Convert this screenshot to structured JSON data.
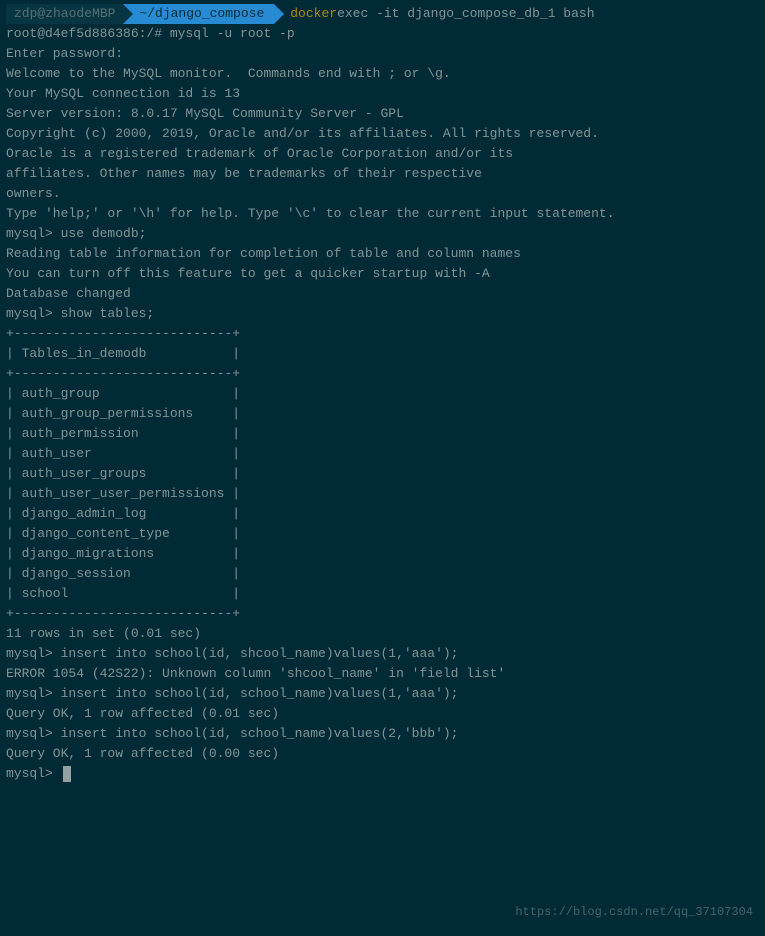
{
  "prompt": {
    "user_host": "zdp@zhaodeMBP",
    "path": "~/django_compose",
    "command_prefix": "docker",
    "command_args": " exec -it django_compose_db_1 bash"
  },
  "lines": {
    "l1": "root@d4ef5d886386:/# mysql -u root -p",
    "l2": "Enter password:",
    "l3": "Welcome to the MySQL monitor.  Commands end with ; or \\g.",
    "l4": "Your MySQL connection id is 13",
    "l5": "Server version: 8.0.17 MySQL Community Server - GPL",
    "l6": "",
    "l7": "Copyright (c) 2000, 2019, Oracle and/or its affiliates. All rights reserved.",
    "l8": "",
    "l9": "Oracle is a registered trademark of Oracle Corporation and/or its",
    "l10": "affiliates. Other names may be trademarks of their respective",
    "l11": "owners.",
    "l12": "",
    "l13": "Type 'help;' or '\\h' for help. Type '\\c' to clear the current input statement.",
    "l14": "",
    "l15": "mysql> use demodb;",
    "l16": "Reading table information for completion of table and column names",
    "l17": "You can turn off this feature to get a quicker startup with -A",
    "l18": "",
    "l19": "Database changed",
    "l20": "mysql> show tables;",
    "l21": "+----------------------------+",
    "l22": "| Tables_in_demodb           |",
    "l23": "+----------------------------+",
    "l24": "| auth_group                 |",
    "l25": "| auth_group_permissions     |",
    "l26": "| auth_permission            |",
    "l27": "| auth_user                  |",
    "l28": "| auth_user_groups           |",
    "l29": "| auth_user_user_permissions |",
    "l30": "| django_admin_log           |",
    "l31": "| django_content_type        |",
    "l32": "| django_migrations          |",
    "l33": "| django_session             |",
    "l34": "| school                     |",
    "l35": "+----------------------------+",
    "l36": "11 rows in set (0.01 sec)",
    "l37": "",
    "l38": "mysql> insert into school(id, shcool_name)values(1,'aaa');",
    "l39": "ERROR 1054 (42S22): Unknown column 'shcool_name' in 'field list'",
    "l40": "mysql> insert into school(id, school_name)values(1,'aaa');",
    "l41": "Query OK, 1 row affected (0.01 sec)",
    "l42": "",
    "l43": "mysql> insert into school(id, school_name)values(2,'bbb');",
    "l44": "Query OK, 1 row affected (0.00 sec)",
    "l45": "",
    "l46": "mysql> "
  },
  "watermark": "https://blog.csdn.net/qq_37107304"
}
